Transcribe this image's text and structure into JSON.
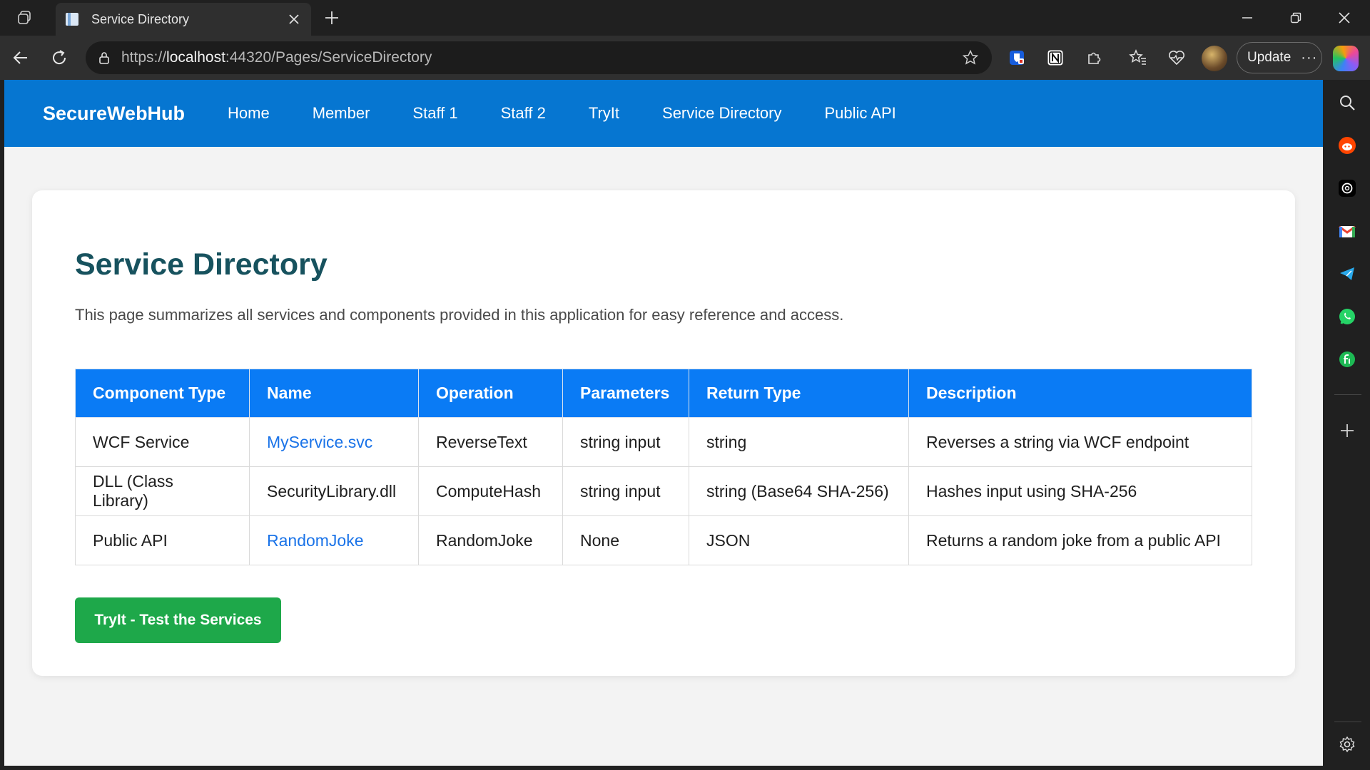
{
  "browser": {
    "tab_title": "Tab title: Service Directory",
    "tab_label": "Service Directory",
    "url_prefix": "https://",
    "url_host": "localhost",
    "url_rest": ":44320/Pages/ServiceDirectory",
    "update_label": "Update",
    "more_label": "···"
  },
  "site": {
    "brand": "SecureWebHub",
    "nav": [
      "Home",
      "Member",
      "Staff 1",
      "Staff 2",
      "TryIt",
      "Service Directory",
      "Public API"
    ]
  },
  "page": {
    "title": "Service Directory",
    "intro": "This page summarizes all services and components provided in this application for easy reference and access.",
    "table": {
      "headers": [
        "Component Type",
        "Name",
        "Operation",
        "Parameters",
        "Return Type",
        "Description"
      ],
      "rows": [
        [
          "WCF Service",
          "MyService.svc",
          "ReverseText",
          "string input",
          "string",
          "Reverses a string via WCF endpoint"
        ],
        [
          "DLL (Class Library)",
          "SecurityLibrary.dll",
          "ComputeHash",
          "string input",
          "string (Base64 SHA-256)",
          "Hashes input using SHA-256"
        ],
        [
          "Public API",
          "RandomJoke",
          "RandomJoke",
          "None",
          "JSON",
          "Returns a random joke from a public API"
        ]
      ]
    },
    "tryit_button": "TryIt - Test the Services"
  },
  "colors": {
    "nav_bg": "#0676d1",
    "table_header_bg": "#0a7bf5",
    "title_color": "#17525e",
    "button_green": "#1ea84a",
    "link_blue": "#1a73e8"
  }
}
